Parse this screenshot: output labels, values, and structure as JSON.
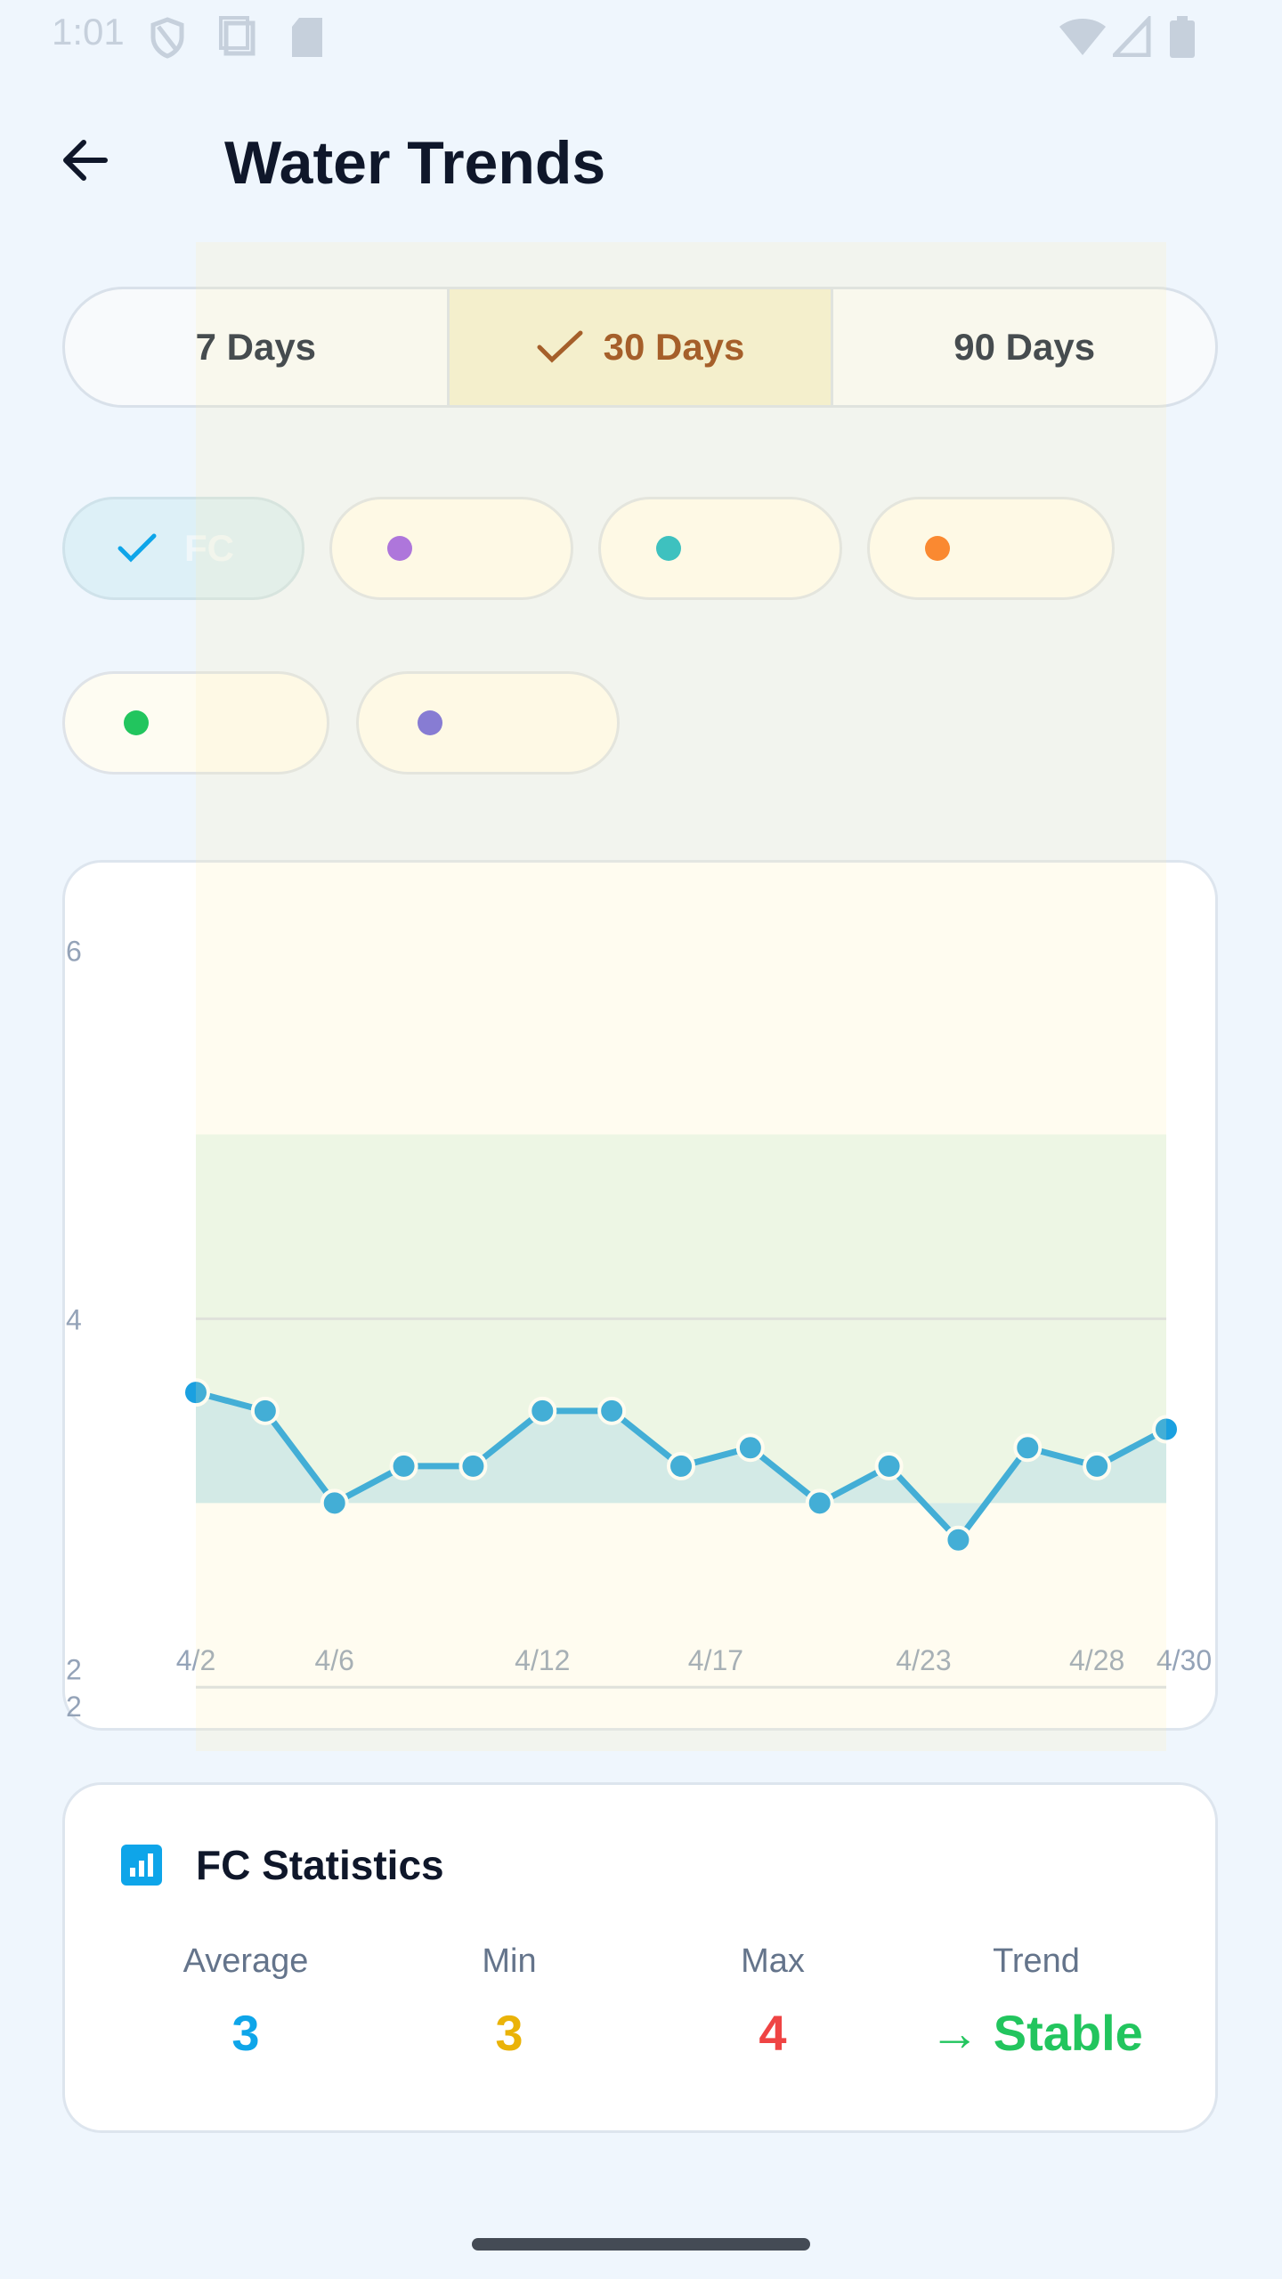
{
  "status_bar": {
    "time": "1:01"
  },
  "header": {
    "title": "Water Trends",
    "back_icon": "arrow-left-icon"
  },
  "range_tabs": [
    {
      "label": "7 Days",
      "selected": false
    },
    {
      "label": "30 Days",
      "selected": true
    },
    {
      "label": "90 Days",
      "selected": false
    }
  ],
  "filter_chips": [
    {
      "label": "FC",
      "color": "#0ea5e9",
      "selected": true
    },
    {
      "label": "",
      "color": "#9d5ce6",
      "selected": false
    },
    {
      "label": "",
      "color": "#14b8c4",
      "selected": false
    },
    {
      "label": "",
      "color": "#f97316",
      "selected": false
    },
    {
      "label": "",
      "color": "#22c55e",
      "selected": false
    },
    {
      "label": "",
      "color": "#6d63dc",
      "selected": false
    }
  ],
  "chart_data": {
    "type": "line",
    "series": [
      {
        "name": "FC",
        "color": "#1aa0e0",
        "x": [
          "4/2",
          "4/4",
          "4/6",
          "4/8",
          "4/10",
          "4/12",
          "4/14",
          "4/16",
          "4/18",
          "4/20",
          "4/22",
          "4/24",
          "4/26",
          "4/28",
          "4/30"
        ],
        "values": [
          3.6,
          3.5,
          3.0,
          3.2,
          3.2,
          3.5,
          3.5,
          3.2,
          3.3,
          3.0,
          3.2,
          2.8,
          3.3,
          3.2,
          3.4
        ]
      }
    ],
    "x_tick_labels": [
      "4/2",
      "4/6",
      "4/12",
      "4/17",
      "4/23",
      "4/28",
      "4/30"
    ],
    "y_tick_labels": [
      "6",
      "4",
      "2",
      "2"
    ],
    "ylim": [
      1.9,
      6.2
    ],
    "ideal_range": [
      3.0,
      5.0
    ],
    "grid": true
  },
  "stats": {
    "title": "FC Statistics",
    "items": [
      {
        "label": "Average",
        "value": "3",
        "color": "#0ea5e9"
      },
      {
        "label": "Min",
        "value": "3",
        "color": "#eab308"
      },
      {
        "label": "Max",
        "value": "4",
        "color": "#ef4444"
      },
      {
        "label": "Trend",
        "value": "→ Stable",
        "color": "#22c55e"
      }
    ]
  }
}
